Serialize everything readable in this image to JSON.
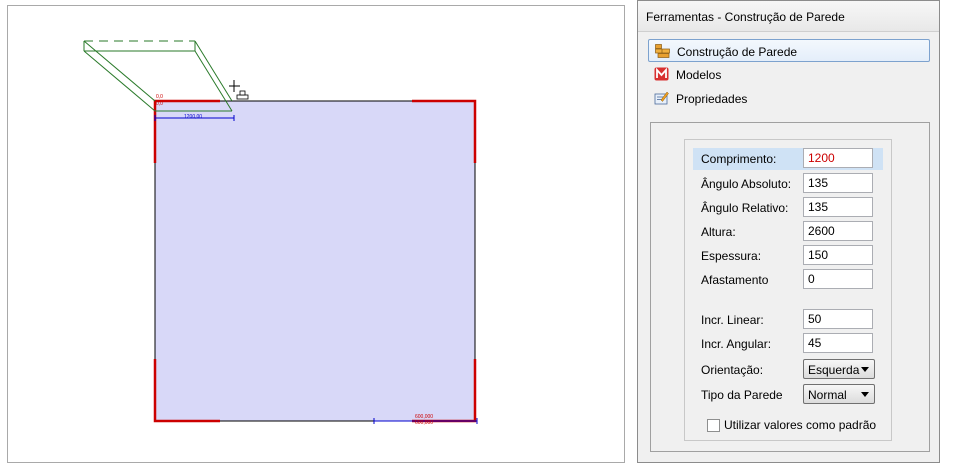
{
  "panel": {
    "title": "Ferramentas - Construção de Parede",
    "nav": [
      {
        "label": "Construção de Parede",
        "icon": "wall-construction-icon",
        "active": true
      },
      {
        "label": "Modelos",
        "icon": "models-icon"
      },
      {
        "label": "Propriedades",
        "icon": "properties-icon"
      }
    ]
  },
  "props": {
    "comprimento": {
      "label": "Comprimento:",
      "value": "1200"
    },
    "angulo_absoluto": {
      "label": "Ângulo Absoluto:",
      "value": "135"
    },
    "angulo_relativo": {
      "label": "Ângulo Relativo:",
      "value": "135"
    },
    "altura": {
      "label": "Altura:",
      "value": "2600"
    },
    "espessura": {
      "label": "Espessura:",
      "value": "150"
    },
    "afastamento": {
      "label": "Afastamento",
      "value": "0"
    },
    "incr_linear": {
      "label": "Incr. Linear:",
      "value": "50"
    },
    "incr_angular": {
      "label": "Incr. Angular:",
      "value": "45"
    },
    "orientacao": {
      "label": "Orientação:",
      "value": "Esquerda"
    },
    "tipo_parede": {
      "label": "Tipo da Parede",
      "value": "Normal"
    },
    "usar_padrao": {
      "label": "Utilizar valores como padrão",
      "checked": false
    }
  },
  "canvas": {
    "dim_top": "1200,00",
    "dim_bottom_1": "600,000",
    "dim_bottom_2": "600,000",
    "corner_a": "0,0",
    "corner_b": "0,0",
    "colors": {
      "room_fill": "#d8d8f8",
      "wall": "#cc0000",
      "preview": "#2a7a2a",
      "dimension": "#0000cc"
    }
  }
}
